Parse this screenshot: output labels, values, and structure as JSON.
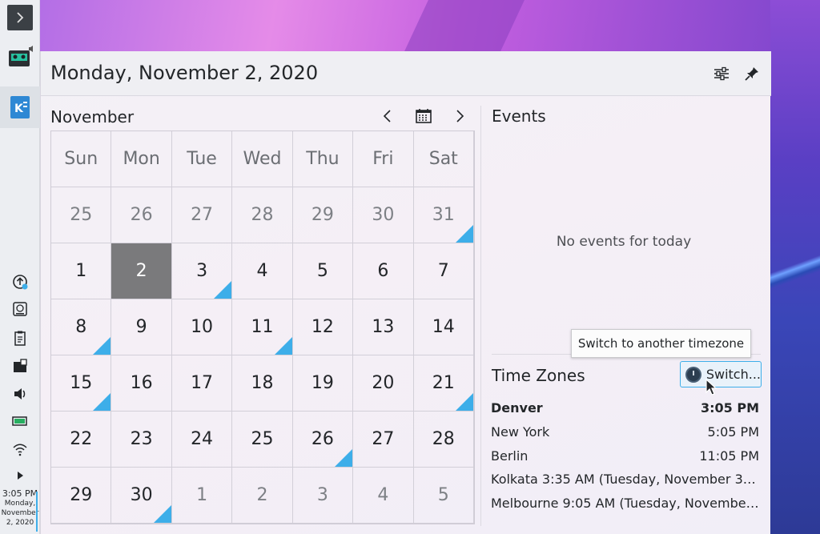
{
  "panel": {
    "clock_time": "3:05 PM",
    "clock_date_line1": "Monday,",
    "clock_date_line2": "November",
    "clock_date_line3": "2, 2020",
    "tray_icons": [
      "updates-icon",
      "disks-icon",
      "clipboard-icon",
      "vaults-icon",
      "volume-icon",
      "battery-icon",
      "wifi-icon",
      "expand-tray-icon"
    ]
  },
  "popup": {
    "header_title": "Monday, November 2, 2020",
    "month_title": "November",
    "weekdays": [
      "Sun",
      "Mon",
      "Tue",
      "Wed",
      "Thu",
      "Fri",
      "Sat"
    ],
    "weeks": [
      [
        {
          "d": "25",
          "o": true
        },
        {
          "d": "26",
          "o": true
        },
        {
          "d": "27",
          "o": true
        },
        {
          "d": "28",
          "o": true
        },
        {
          "d": "29",
          "o": true
        },
        {
          "d": "30",
          "o": true
        },
        {
          "d": "31",
          "o": true,
          "e": true
        }
      ],
      [
        {
          "d": "1"
        },
        {
          "d": "2",
          "sel": true
        },
        {
          "d": "3",
          "e": true
        },
        {
          "d": "4"
        },
        {
          "d": "5"
        },
        {
          "d": "6"
        },
        {
          "d": "7"
        }
      ],
      [
        {
          "d": "8",
          "e": true
        },
        {
          "d": "9"
        },
        {
          "d": "10"
        },
        {
          "d": "11",
          "e": true
        },
        {
          "d": "12"
        },
        {
          "d": "13"
        },
        {
          "d": "14"
        }
      ],
      [
        {
          "d": "15",
          "e": true
        },
        {
          "d": "16"
        },
        {
          "d": "17"
        },
        {
          "d": "18"
        },
        {
          "d": "19"
        },
        {
          "d": "20"
        },
        {
          "d": "21",
          "e": true
        }
      ],
      [
        {
          "d": "22"
        },
        {
          "d": "23"
        },
        {
          "d": "24"
        },
        {
          "d": "25"
        },
        {
          "d": "26",
          "e": true
        },
        {
          "d": "27"
        },
        {
          "d": "28"
        }
      ],
      [
        {
          "d": "29"
        },
        {
          "d": "30",
          "e": true
        },
        {
          "d": "1",
          "o": true
        },
        {
          "d": "2",
          "o": true
        },
        {
          "d": "3",
          "o": true
        },
        {
          "d": "4",
          "o": true
        },
        {
          "d": "5",
          "o": true
        }
      ]
    ],
    "events_title": "Events",
    "no_events": "No events for today",
    "timezones_title": "Time Zones",
    "switch_label": "Switch...",
    "tooltip": "Switch to another timezone",
    "timezones": [
      {
        "city": "Denver",
        "time": "3:05 PM",
        "bold": true
      },
      {
        "city": "New York",
        "time": "5:05 PM"
      },
      {
        "city": "Berlin",
        "time": "11:05 PM"
      },
      {
        "full": "Kolkata  3:35 AM (Tuesday, November 3, 2…"
      },
      {
        "full": "Melbourne  9:05 AM (Tuesday, November …"
      }
    ]
  },
  "colors": {
    "accent": "#3daee9",
    "selected_day": "#7a7a7c"
  }
}
